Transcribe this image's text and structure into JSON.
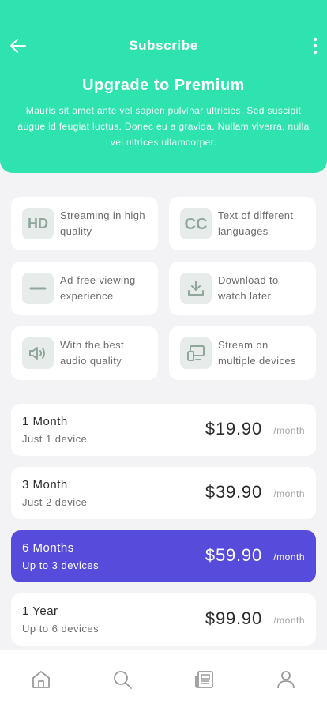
{
  "header": {
    "title": "Subscribe",
    "headline": "Upgrade to Premium",
    "description": "Mauris sit amet ante vel sapien pulvinar ultricies. Sed suscipit augue id feugiat luctus. Donec eu a gravida. Nullam viverra, nulla vel ultrices ullamcorper."
  },
  "features": [
    {
      "icon": "hd-icon",
      "label": "Streaming in high quality"
    },
    {
      "icon": "cc-icon",
      "label": "Text of different languages"
    },
    {
      "icon": "minus-icon",
      "label": "Ad-free viewing experience"
    },
    {
      "icon": "download-icon",
      "label": "Download to watch later"
    },
    {
      "icon": "speaker-icon",
      "label": "With the best audio quality"
    },
    {
      "icon": "multi-device-icon",
      "label": "Stream on multiple devices"
    }
  ],
  "plans": [
    {
      "name": "1 Month",
      "devices": "Just 1 device",
      "price": "$19.90",
      "period": "/month",
      "selected": false
    },
    {
      "name": "3 Month",
      "devices": "Just 2 device",
      "price": "$39.90",
      "period": "/month",
      "selected": false
    },
    {
      "name": "6 Months",
      "devices": "Up to 3 devices",
      "price": "$59.90",
      "period": "/month",
      "selected": true
    },
    {
      "name": "1 Year",
      "devices": "Up to 6 devices",
      "price": "$99.90",
      "period": "/month",
      "selected": false
    }
  ],
  "tabs": [
    "home-icon",
    "search-icon",
    "news-icon",
    "profile-icon"
  ],
  "colors": {
    "accent": "#2ee3ad",
    "selected": "#574bdc",
    "icon": "#8fa79b"
  }
}
